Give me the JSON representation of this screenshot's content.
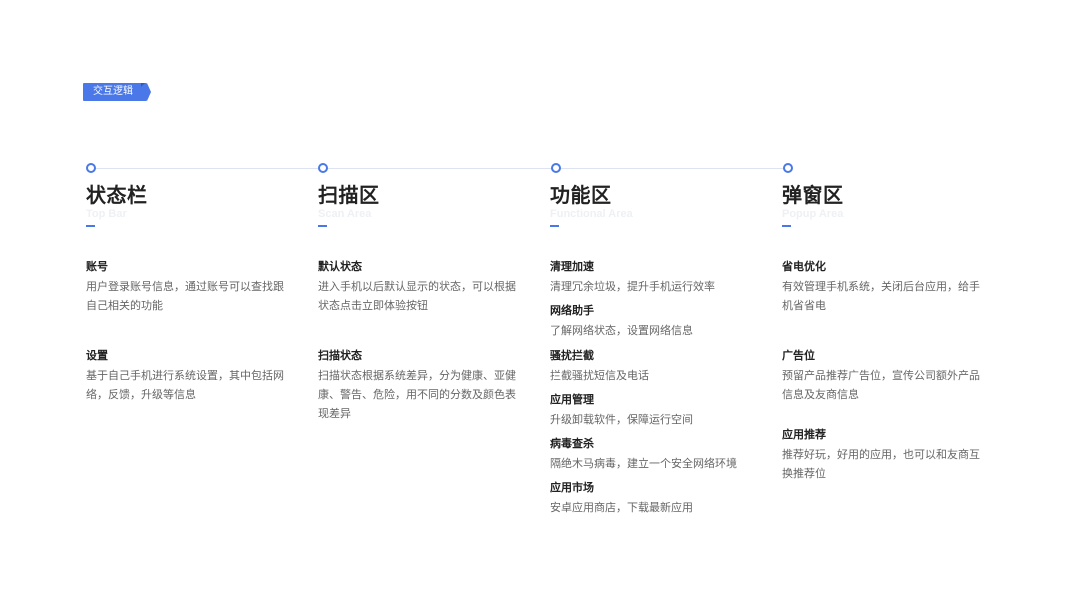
{
  "badge": {
    "label": "交互逻辑"
  },
  "columns": [
    {
      "title": "状态栏",
      "subtitle": "Top Bar",
      "items": [
        {
          "title": "账号",
          "desc": "用户登录账号信息，通过账号可以查找跟自己相关的功能"
        },
        {
          "title": "设置",
          "desc": "基于自己手机进行系统设置，其中包括网络，反馈，升级等信息"
        }
      ]
    },
    {
      "title": "扫描区",
      "subtitle": "Scan Area",
      "items": [
        {
          "title": "默认状态",
          "desc": "进入手机以后默认显示的状态，可以根据状态点击立即体验按钮"
        },
        {
          "title": "扫描状态",
          "desc": "扫描状态根据系统差异，分为健康、亚健康、警告、危险，用不同的分数及颜色表现差异"
        }
      ]
    },
    {
      "title": "功能区",
      "subtitle": "Functional Area",
      "items": [
        {
          "title": "清理加速",
          "desc": "清理冗余垃圾，提升手机运行效率"
        },
        {
          "title": "网络助手",
          "desc": "了解网络状态，设置网络信息"
        },
        {
          "title": "骚扰拦截",
          "desc": "拦截骚扰短信及电话"
        },
        {
          "title": "应用管理",
          "desc": "升级卸载软件，保障运行空间"
        },
        {
          "title": "病毒查杀",
          "desc": "隔绝木马病毒，建立一个安全网络环境"
        },
        {
          "title": "应用市场",
          "desc": "安卓应用商店，下载最新应用"
        }
      ]
    },
    {
      "title": "弹窗区",
      "subtitle": "Popup Area",
      "items": [
        {
          "title": "省电优化",
          "desc": "有效管理手机系统，关闭后台应用，给手机省省电"
        },
        {
          "title": "广告位",
          "desc": "预留产品推荐广告位，宣传公司额外产品信息及友商信息"
        },
        {
          "title": "应用推荐",
          "desc": "推荐好玩，好用的应用，也可以和友商互换推荐位"
        }
      ]
    }
  ]
}
